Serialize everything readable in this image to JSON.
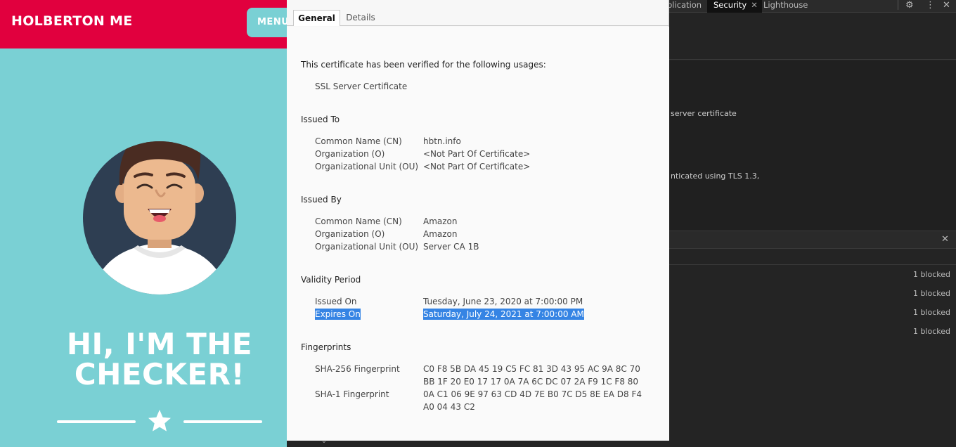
{
  "site": {
    "brand": "HOLBERTON ME",
    "menu_label": "MENU",
    "hero_line1": "HI, I'M THE",
    "hero_line2": "CHECKER!",
    "chevron": "⌄"
  },
  "devtools": {
    "tabs": [
      "plication",
      "Security",
      "Lighthouse"
    ],
    "active_tab_close": "✕",
    "gear": "⚙",
    "kebab": "⋮",
    "close": "✕",
    "line1": "server certificate",
    "line2": "nticated using TLS 1.3,",
    "drawer_close": "✕",
    "blocked_rows": [
      "1 blocked",
      "1 blocked",
      "1 blocked",
      "1 blocked"
    ]
  },
  "cert": {
    "tabs": {
      "general": "General",
      "details": "Details"
    },
    "usage_heading": "This certificate has been verified for the following usages:",
    "usage_value": "SSL Server Certificate",
    "issued_to": {
      "heading": "Issued To",
      "cn_label": "Common Name (CN)",
      "cn_value": "hbtn.info",
      "o_label": "Organization (O)",
      "o_value": "<Not Part Of Certificate>",
      "ou_label": "Organizational Unit (OU)",
      "ou_value": "<Not Part Of Certificate>"
    },
    "issued_by": {
      "heading": "Issued By",
      "cn_label": "Common Name (CN)",
      "cn_value": "Amazon",
      "o_label": "Organization (O)",
      "o_value": "Amazon",
      "ou_label": "Organizational Unit (OU)",
      "ou_value": "Server CA 1B"
    },
    "validity": {
      "heading": "Validity Period",
      "issued_label": "Issued On",
      "issued_value": "Tuesday, June 23, 2020 at 7:00:00 PM",
      "expires_label": "Expires On",
      "expires_value": "Saturday, July 24, 2021 at 7:00:00 AM"
    },
    "fingerprints": {
      "heading": "Fingerprints",
      "sha256_label": "SHA-256 Fingerprint",
      "sha256_line1": "C0 F8 5B DA 45 19 C5 FC 81 3D 43 95 AC 9A 8C 70",
      "sha256_line2": "BB 1F 20 E0 17 17 0A 7A 6C DC 07 2A F9 1C F8 80",
      "sha1_label": "SHA-1 Fingerprint",
      "sha1_line1": "0A C1 06 9E 97 63 CD 4D 7E B0 7C D5 8E EA D8 F4",
      "sha1_line2": "A0 04 43 C2"
    }
  },
  "colors": {
    "header_red": "#e1003e",
    "page_teal": "#7ad0d4",
    "avatar_navy": "#2e3e52",
    "selection_blue": "#3584e4"
  }
}
